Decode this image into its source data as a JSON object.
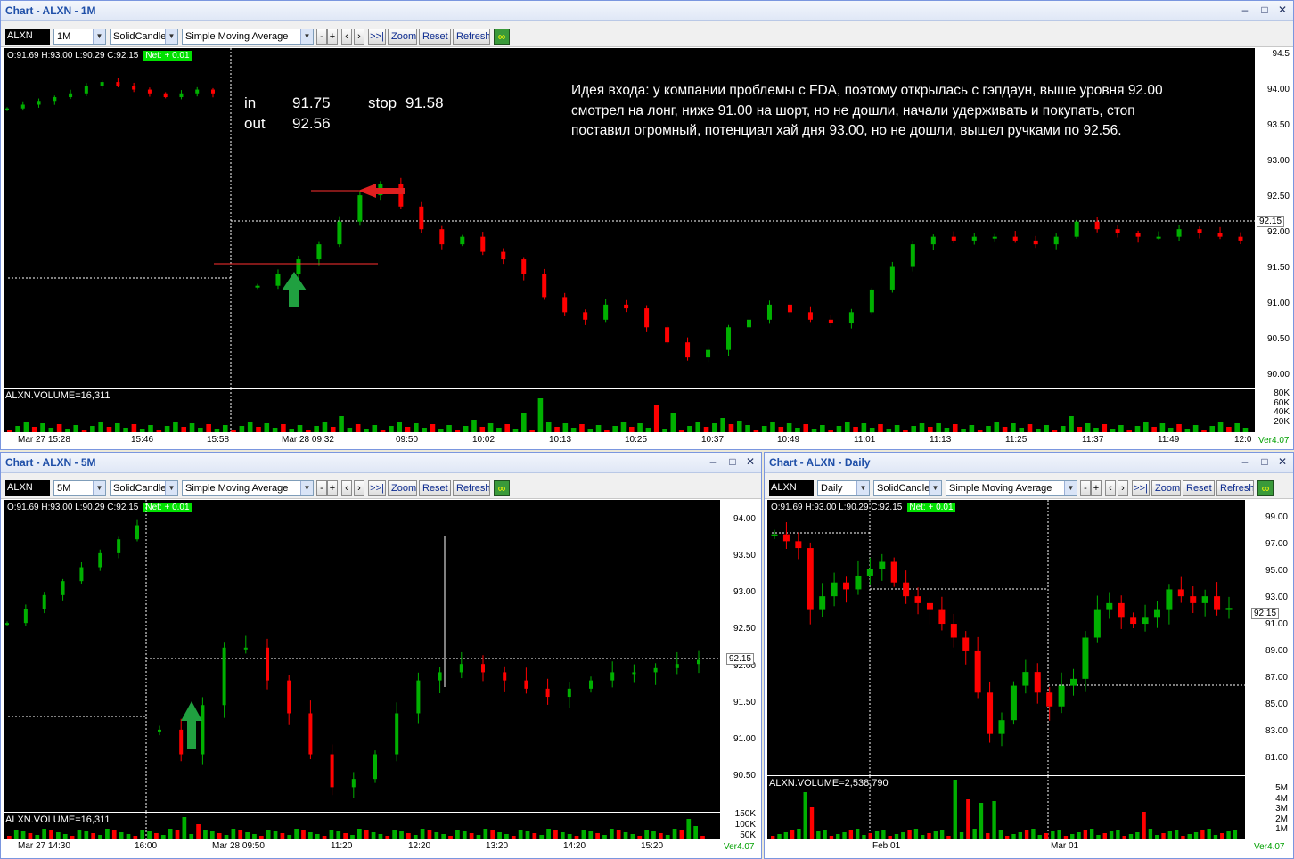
{
  "top": {
    "title": "Chart - ALXN - 1M",
    "symbol": "ALXN",
    "interval": "1M",
    "chart_style": "SolidCandle",
    "indicator": "Simple Moving Average",
    "buttons": {
      "minus": "-",
      "plus": "+",
      "back": "‹",
      "fwd": "›",
      "end": ">>|",
      "zoom": "Zoom",
      "reset": "Reset",
      "refresh": "Refresh"
    },
    "ohlc": "O:91.69  H:93.00  L:90.29  C:92.15",
    "net": "Net: + 0.01",
    "price_tag": "92.15",
    "volume_label": "ALXN.VOLUME=16,311",
    "version": "Ver4.07",
    "y_ticks": [
      "94.5",
      "94.00",
      "93.50",
      "93.00",
      "92.50",
      "92.00",
      "91.50",
      "91.00",
      "90.50",
      "90.00"
    ],
    "vol_ticks": [
      "80K",
      "60K",
      "40K",
      "20K"
    ],
    "x_ticks": [
      "Mar 27 15:28",
      "15:46",
      "15:58",
      "Mar 28 09:32",
      "09:50",
      "10:02",
      "10:13",
      "10:25",
      "10:37",
      "10:49",
      "11:01",
      "11:13",
      "11:25",
      "11:37",
      "11:49",
      "12:0"
    ],
    "annotation": {
      "in_label": "in",
      "in_value": "91.75",
      "stop_label": "stop",
      "stop_value": "91.58",
      "out_label": "out",
      "out_value": "92.56",
      "idea_line1": "Идея входа: у компании проблемы с FDA, поэтому открылась с гэпдаун, выше уровня 92.00",
      "idea_line2": "смотрел на лонг, ниже 91.00 на шорт, но не дошли, начали удерживать и покупать, стоп",
      "idea_line3": "поставил огромный, потенциал хай дня 93.00,  но не дошли,   вышел ручками по 92.56."
    }
  },
  "bl": {
    "title": "Chart - ALXN - 5M",
    "symbol": "ALXN",
    "interval": "5M",
    "chart_style": "SolidCandle",
    "indicator": "Simple Moving Average",
    "buttons": {
      "minus": "-",
      "plus": "+",
      "back": "‹",
      "fwd": "›",
      "end": ">>|",
      "zoom": "Zoom",
      "reset": "Reset",
      "refresh": "Refresh"
    },
    "ohlc": "O:91.69  H:93.00  L:90.29  C:92.15",
    "net": "Net: + 0.01",
    "price_tag": "92.15",
    "volume_label": "ALXN.VOLUME=16,311",
    "version": "Ver4.07",
    "y_ticks": [
      "94.00",
      "93.50",
      "93.00",
      "92.50",
      "92.00",
      "91.50",
      "91.00",
      "90.50"
    ],
    "vol_ticks": [
      "150K",
      "100K",
      "50K"
    ],
    "x_ticks": [
      "Mar 27 14:30",
      "16:00",
      "Mar 28 09:50",
      "11:20",
      "12:20",
      "13:20",
      "14:20",
      "15:20"
    ]
  },
  "br": {
    "title": "Chart - ALXN - Daily",
    "symbol": "ALXN",
    "interval": "Daily",
    "chart_style": "SolidCandle",
    "indicator": "Simple Moving Average",
    "buttons": {
      "minus": "-",
      "plus": "+",
      "back": "‹",
      "fwd": "›",
      "end": ">>|",
      "zoom": "Zoom",
      "reset": "Reset",
      "refresh": "Refresh"
    },
    "ohlc": "O:91.69  H:93.00  L:90.29  C:92.15",
    "net": "Net: + 0.01",
    "price_tag": "92.15",
    "volume_label": "ALXN.VOLUME=2,538,790",
    "version": "Ver4.07",
    "y_ticks": [
      "99.00",
      "97.00",
      "95.00",
      "93.00",
      "91.00",
      "89.00",
      "87.00",
      "85.00",
      "83.00",
      "81.00"
    ],
    "vol_ticks": [
      "5M",
      "4M",
      "3M",
      "2M",
      "1M"
    ],
    "x_ticks": [
      "Feb 01",
      "Mar 01"
    ]
  },
  "colors": {
    "up": "#00b000",
    "down": "#ff0000",
    "grid": "#ffffff",
    "arrow_green": "#20a040",
    "arrow_red": "#e02020"
  },
  "chart_data": [
    {
      "type": "candlestick",
      "title": "Chart - ALXN - 1M",
      "ylim": [
        90.0,
        94.5
      ],
      "approx_closes": [
        91.35,
        91.5,
        91.7,
        91.9,
        92.2,
        92.55,
        92.7,
        92.4,
        92.1,
        91.9,
        92.0,
        91.8,
        91.7,
        91.5,
        91.2,
        91.0,
        90.9,
        91.1,
        91.05,
        90.8,
        90.6,
        90.4,
        90.5,
        90.8,
        90.9,
        91.1,
        91.0,
        90.9,
        90.85,
        91.0,
        91.3,
        91.6,
        91.9,
        92.0,
        91.95,
        92.0,
        92.0,
        91.95,
        91.9,
        92.0,
        92.2,
        92.1,
        92.05,
        92.0,
        92.0,
        92.1,
        92.05,
        92.0,
        91.95
      ],
      "volume_ylim": [
        0,
        80000
      ]
    },
    {
      "type": "candlestick",
      "title": "Chart - ALXN - 5M",
      "ylim": [
        90.3,
        94.1
      ],
      "approx_closes": [
        92.7,
        92.8,
        92.9,
        93.1,
        93.4,
        93.7,
        93.9,
        93.8,
        91.3,
        91.0,
        91.6,
        92.3,
        92.3,
        91.9,
        91.5,
        91.0,
        90.6,
        90.7,
        91.0,
        91.5,
        91.9,
        92.0,
        92.1,
        92.0,
        91.9,
        91.8,
        91.7,
        91.8,
        91.9,
        92.0,
        92.0,
        92.05,
        92.1,
        92.15
      ],
      "volume_ylim": [
        0,
        150000
      ]
    },
    {
      "type": "candlestick",
      "title": "Chart - ALXN - Daily",
      "ylim": [
        80.0,
        100.0
      ],
      "approx_closes": [
        97.5,
        97.0,
        96.5,
        92.0,
        93.0,
        94.0,
        93.5,
        94.5,
        95.0,
        95.5,
        94.0,
        93.0,
        92.5,
        92.0,
        91.0,
        90.0,
        89.0,
        86.0,
        83.0,
        84.0,
        86.5,
        87.5,
        86.0,
        85.0,
        86.5,
        87.0,
        90.0,
        92.0,
        92.5,
        91.5,
        91.0,
        91.5,
        92.0,
        93.5,
        93.0,
        92.5,
        93.0,
        92.0,
        92.15
      ],
      "volume_ylim": [
        0,
        5000000
      ]
    }
  ]
}
